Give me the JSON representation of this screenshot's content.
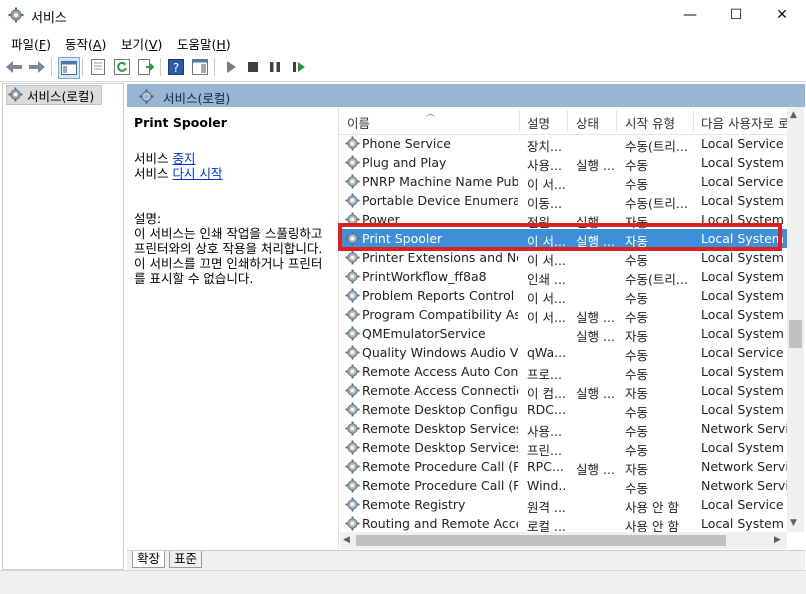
{
  "window": {
    "title": "서비스",
    "minimize": "—",
    "maximize": "☐",
    "close": "✕"
  },
  "menu": [
    {
      "label": "파일(",
      "key": "F",
      "end": ")"
    },
    {
      "label": "동작(",
      "key": "A",
      "end": ")"
    },
    {
      "label": "보기(",
      "key": "V",
      "end": ")"
    },
    {
      "label": "도움말(",
      "key": "H",
      "end": ")"
    }
  ],
  "tree": {
    "item": "서비스(로컬)"
  },
  "panel": {
    "title": "서비스(로컬)"
  },
  "details": {
    "service_name": "Print Spooler",
    "stop_prefix": "서비스 ",
    "stop_link": "중지",
    "restart_prefix": "서비스 ",
    "restart_link": "다시 시작",
    "desc_label": "설명:",
    "desc_lines": [
      "이 서비스는 인쇄 작업을 스풀링하고",
      "프린터와의 상호 작용을 처리합니다.",
      "이 서비스를 끄면 인쇄하거나 프린터",
      "를 표시할 수 없습니다."
    ]
  },
  "columns": {
    "name": "이름",
    "description": "설명",
    "status": "상태",
    "startup": "시작 유형",
    "logon": "다음 사용자로 로"
  },
  "rows": [
    {
      "name": "Phone Service",
      "desc": "장치...",
      "status": "",
      "startup": "수동(트리...",
      "logon": "Local Service"
    },
    {
      "name": "Plug and Play",
      "desc": "사용...",
      "status": "실행 ...",
      "startup": "수동",
      "logon": "Local System"
    },
    {
      "name": "PNRP Machine Name Publi...",
      "desc": "이 서...",
      "status": "",
      "startup": "수동",
      "logon": "Local Service"
    },
    {
      "name": "Portable Device Enumerato...",
      "desc": "이동...",
      "status": "",
      "startup": "수동(트리...",
      "logon": "Local System"
    },
    {
      "name": "Power",
      "desc": "전원...",
      "status": "실행 ...",
      "startup": "자동",
      "logon": "Local System"
    },
    {
      "name": "Print Spooler",
      "desc": "이 서...",
      "status": "실행 ...",
      "startup": "자동",
      "logon": "Local System",
      "selected": true
    },
    {
      "name": "Printer Extensions and Noti...",
      "desc": "이 서...",
      "status": "",
      "startup": "수동",
      "logon": "Local System"
    },
    {
      "name": "PrintWorkflow_ff8a8",
      "desc": "인쇄 ...",
      "status": "",
      "startup": "수동(트리...",
      "logon": "Local System"
    },
    {
      "name": "Problem Reports Control P...",
      "desc": "이 서...",
      "status": "",
      "startup": "수동",
      "logon": "Local System"
    },
    {
      "name": "Program Compatibility Assi...",
      "desc": "이 서...",
      "status": "실행 ...",
      "startup": "수동",
      "logon": "Local System"
    },
    {
      "name": "QMEmulatorService",
      "desc": "",
      "status": "실행 ...",
      "startup": "자동",
      "logon": "Local System"
    },
    {
      "name": "Quality Windows Audio Vi...",
      "desc": "qWa...",
      "status": "",
      "startup": "수동",
      "logon": "Local Service"
    },
    {
      "name": "Remote Access Auto Conn...",
      "desc": "프로...",
      "status": "",
      "startup": "수동",
      "logon": "Local System"
    },
    {
      "name": "Remote Access Connection...",
      "desc": "이 컴...",
      "status": "실행 ...",
      "startup": "자동",
      "logon": "Local System"
    },
    {
      "name": "Remote Desktop Configura...",
      "desc": "RDC...",
      "status": "",
      "startup": "수동",
      "logon": "Local System"
    },
    {
      "name": "Remote Desktop Services",
      "desc": "사용...",
      "status": "",
      "startup": "수동",
      "logon": "Network Service"
    },
    {
      "name": "Remote Desktop Services ...",
      "desc": "프린...",
      "status": "",
      "startup": "수동",
      "logon": "Local System"
    },
    {
      "name": "Remote Procedure Call (RP...",
      "desc": "RPC...",
      "status": "실행 ...",
      "startup": "자동",
      "logon": "Network Service"
    },
    {
      "name": "Remote Procedure Call (RP...",
      "desc": "Wind...",
      "status": "",
      "startup": "수동",
      "logon": "Network Service"
    },
    {
      "name": "Remote Registry",
      "desc": "원격 ...",
      "status": "",
      "startup": "사용 안 함",
      "logon": "Local Service"
    },
    {
      "name": "Routing and Remote Access",
      "desc": "로컬 ...",
      "status": "",
      "startup": "사용 안 함",
      "logon": "Local System"
    }
  ],
  "tabs": [
    "확장",
    "표준"
  ],
  "colors": {
    "selection": "#3c8fd8",
    "header_band": "#97b6d6",
    "highlight": "#e02020"
  }
}
